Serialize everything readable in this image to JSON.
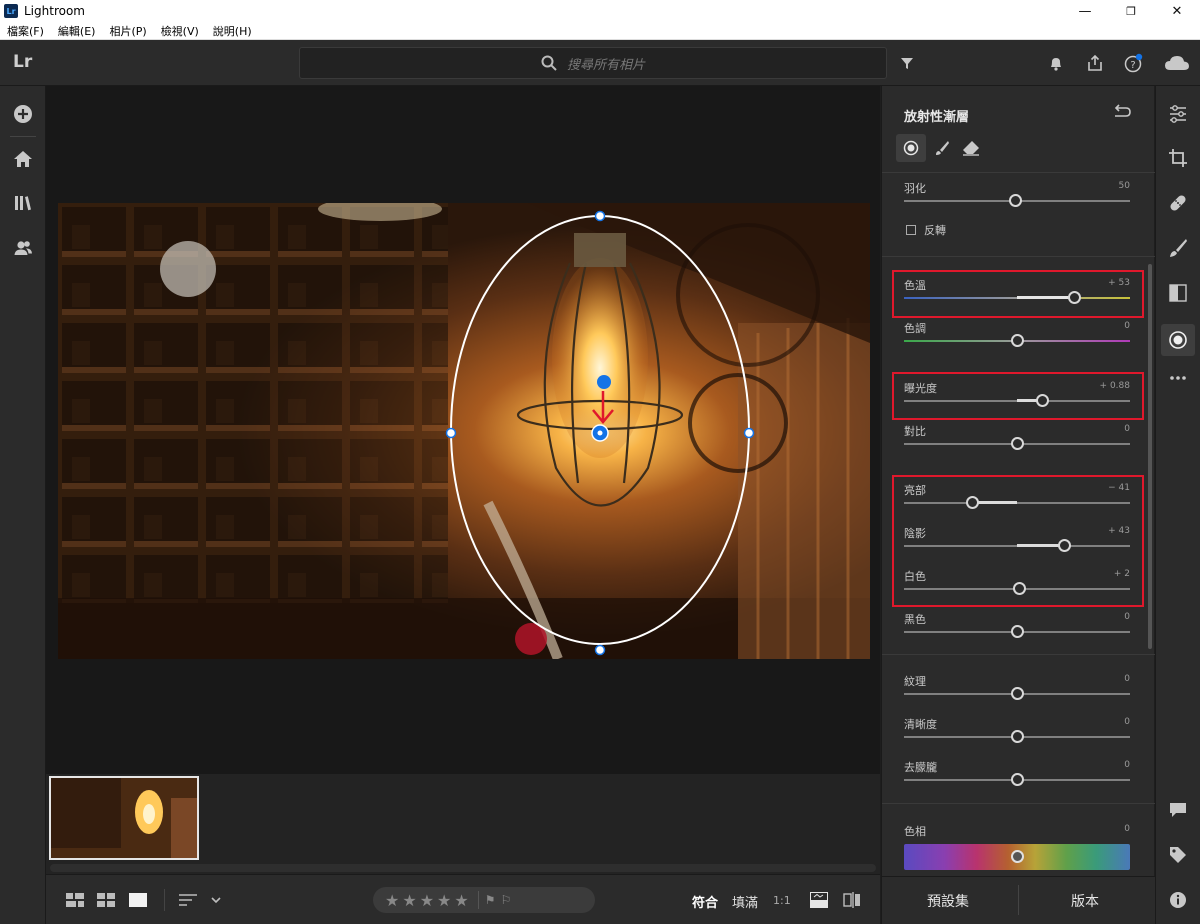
{
  "window": {
    "title": "Lightroom",
    "logo": "Lr",
    "minimize": "—",
    "maximize": "❐",
    "close": "✕"
  },
  "menu": [
    "檔案(F)",
    "編輯(E)",
    "相片(P)",
    "檢視(V)",
    "說明(H)"
  ],
  "toolbar": {
    "app_mark": "Lr",
    "search_placeholder": "搜尋所有相片"
  },
  "panel": {
    "title": "放射性漸層",
    "feather": {
      "label": "羽化",
      "value": "50",
      "level": 0.49
    },
    "invert_label": "反轉",
    "sliders": [
      {
        "key": "temp",
        "label": "色溫",
        "value": "+ 53",
        "level": 0.75
      },
      {
        "key": "tint",
        "label": "色調",
        "value": "0",
        "level": 0.5
      },
      {
        "key": "exposure",
        "label": "曝光度",
        "value": "+ 0.88",
        "level": 0.61
      },
      {
        "key": "contrast",
        "label": "對比",
        "value": "0",
        "level": 0.5
      },
      {
        "key": "highlights",
        "label": "亮部",
        "value": "− 41",
        "level": 0.3
      },
      {
        "key": "shadows",
        "label": "陰影",
        "value": "+ 43",
        "level": 0.71
      },
      {
        "key": "whites",
        "label": "白色",
        "value": "+ 2",
        "level": 0.51
      },
      {
        "key": "blacks",
        "label": "黑色",
        "value": "0",
        "level": 0.5
      },
      {
        "key": "texture",
        "label": "紋理",
        "value": "0",
        "level": 0.5
      },
      {
        "key": "clarity",
        "label": "清晰度",
        "value": "0",
        "level": 0.5
      },
      {
        "key": "dehaze",
        "label": "去朦朧",
        "value": "0",
        "level": 0.5
      }
    ],
    "hue": {
      "label": "色相",
      "value": "0",
      "level": 0.5
    },
    "footer": {
      "presets": "預設集",
      "versions": "版本"
    }
  },
  "bottombar": {
    "fit": "符合",
    "fill": "填滿",
    "one_to_one": "1:1"
  },
  "colors": {
    "highlight": "#e0182c",
    "accent": "#1473e6"
  }
}
